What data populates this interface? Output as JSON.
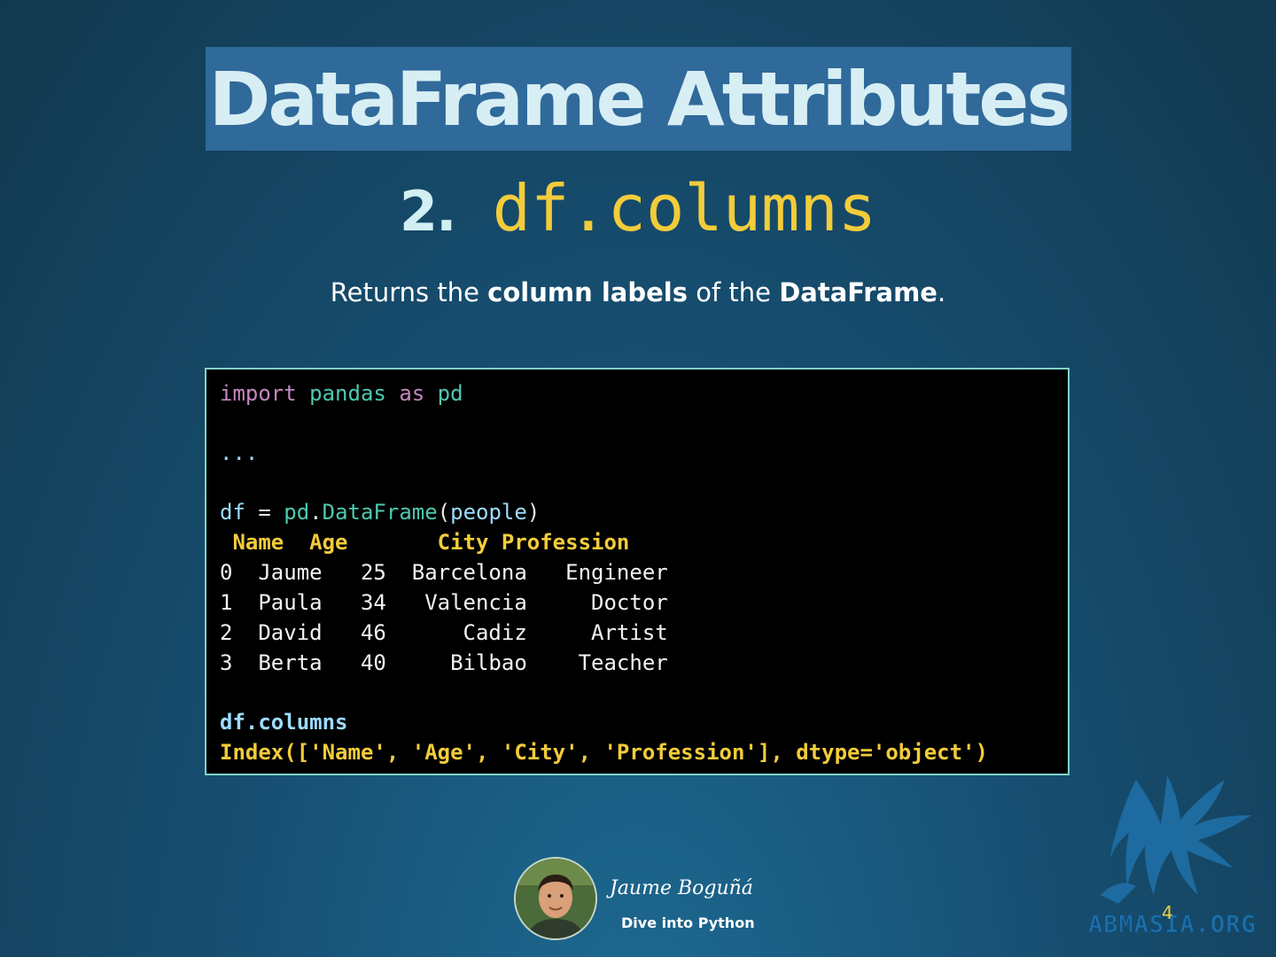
{
  "slide": {
    "title": "DataFrame Attributes",
    "subtitle_number": "2.",
    "subtitle_code": "df.columns",
    "description": {
      "part1": "Returns the ",
      "bold1": "column labels",
      "part2": " of the ",
      "bold2": "DataFrame",
      "part3": "."
    },
    "page_number": "4"
  },
  "code": {
    "import_kw": "import",
    "import_mod": "pandas",
    "as_kw": "as",
    "alias": "pd",
    "ellipsis": "...",
    "df_var": "df",
    "assign": " = ",
    "pd_ref": "pd",
    "dot": ".",
    "class_name": "DataFrame",
    "open_paren": "(",
    "arg": "people",
    "close_paren": ")",
    "table_header": " Name  Age       City Profession",
    "table_rows": [
      "0  Jaume   25  Barcelona   Engineer",
      "1  Paula   34   Valencia     Doctor",
      "2  David   46      Cadiz     Artist",
      "3  Berta   40     Bilbao    Teacher"
    ],
    "call": "df.columns",
    "output": "Index(['Name', 'Age', 'City', 'Profession'], dtype='object')"
  },
  "footer": {
    "author": "Jaume Boguñá",
    "series": "Dive into Python",
    "logo_text": "ABMASIA.ORG"
  },
  "colors": {
    "title_band": "#2f6a9a",
    "accent_yellow": "#f2cc3a",
    "code_border": "#7ed4c8"
  }
}
